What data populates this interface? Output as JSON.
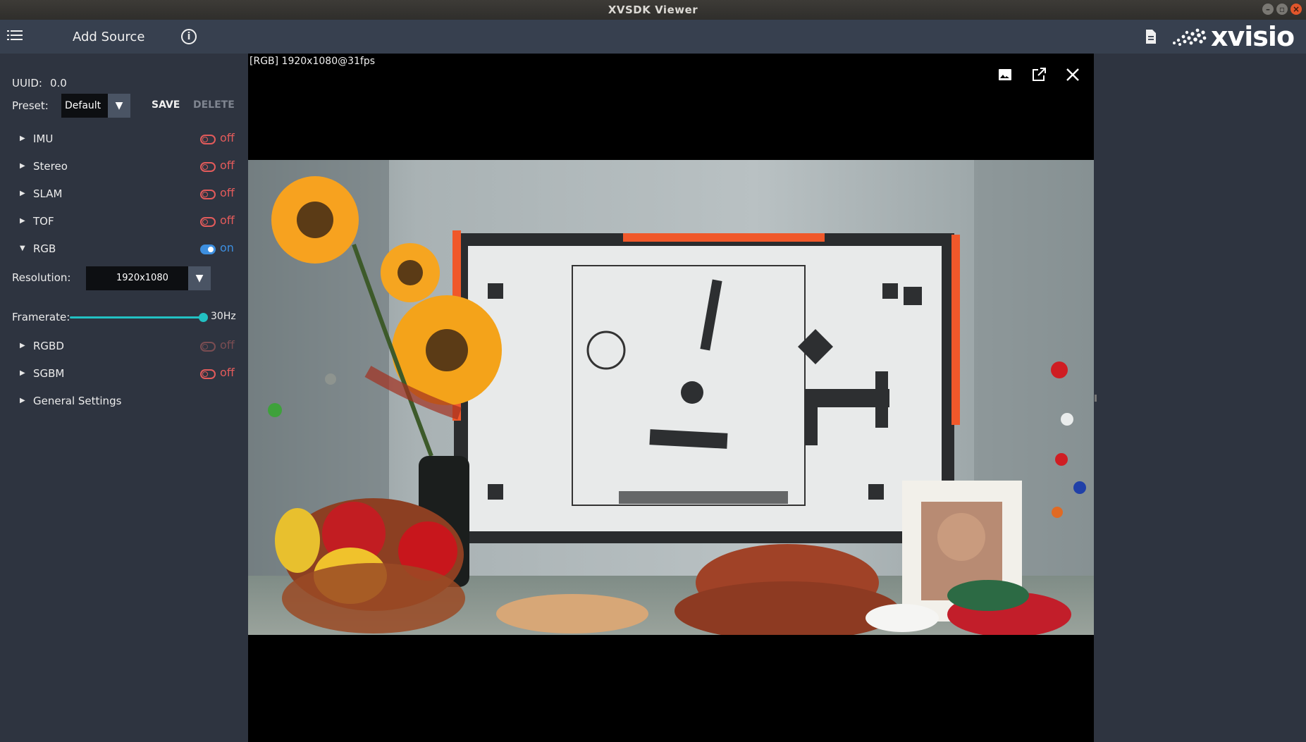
{
  "window": {
    "title": "XVSDK Viewer"
  },
  "toolbar": {
    "menu_icon": "list-menu-icon",
    "add_source_label": "Add Source",
    "info_icon": "info-icon",
    "doc_icon": "document-icon",
    "logo_text": "xvisio"
  },
  "panel": {
    "uuid_label": "UUID:",
    "uuid_value": "0.0",
    "preset_label": "Preset:",
    "preset_value": "Default",
    "save_label": "SAVE",
    "delete_label": "DELETE",
    "sections": [
      {
        "name": "IMU",
        "state": "off",
        "expanded": false
      },
      {
        "name": "Stereo",
        "state": "off",
        "expanded": false
      },
      {
        "name": "SLAM",
        "state": "off",
        "expanded": false
      },
      {
        "name": "TOF",
        "state": "off",
        "expanded": false
      },
      {
        "name": "RGB",
        "state": "on",
        "expanded": true
      },
      {
        "name": "RGBD",
        "state": "off",
        "expanded": false,
        "disabled": true
      },
      {
        "name": "SGBM",
        "state": "off",
        "expanded": false
      },
      {
        "name": "General Settings"
      }
    ],
    "rgb": {
      "resolution_label": "Resolution:",
      "resolution_value": "1920x1080",
      "framerate_label": "Framerate:",
      "framerate_value": "30Hz",
      "framerate_fraction": 1.0
    }
  },
  "viewer": {
    "stream_label": "[RGB]  1920x1080@31fps",
    "icons": [
      "image-icon",
      "open-external-icon",
      "close-icon"
    ]
  },
  "colors": {
    "accent_on": "#3d8fe0",
    "accent_off": "#e35b5b",
    "slider": "#22c1c3",
    "panel_bg": "#2e3440",
    "toolbar_bg": "#37404f"
  }
}
